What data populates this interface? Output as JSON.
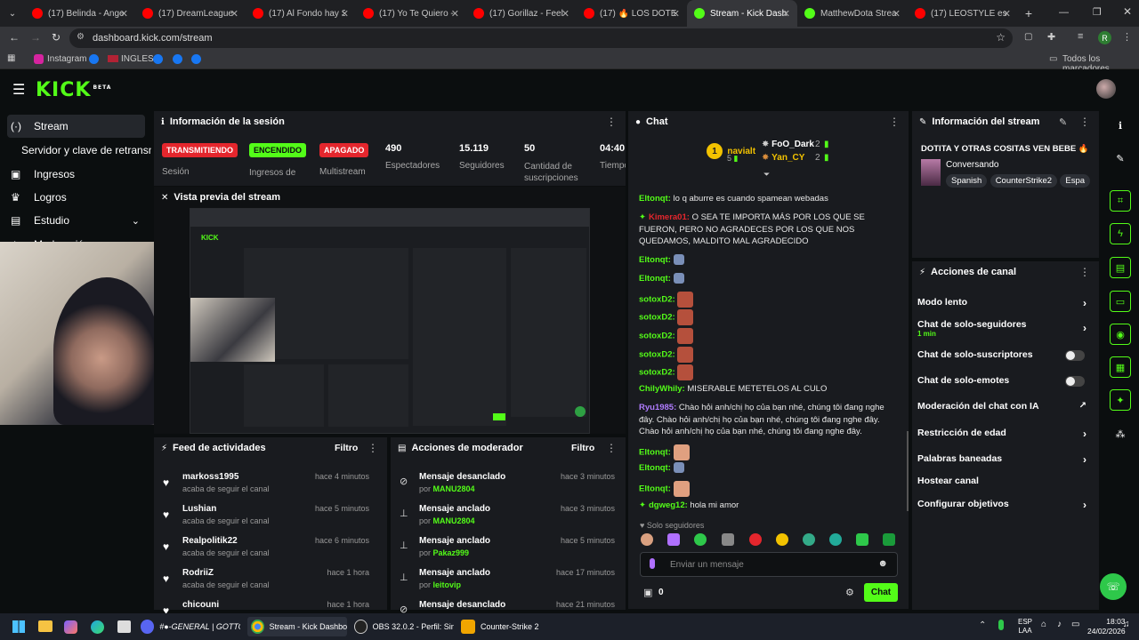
{
  "browser": {
    "tabs": [
      {
        "label": "(17) Belinda - Angel",
        "color": "#ff0000"
      },
      {
        "label": "(17) DreamLeague Se",
        "color": "#ff0000"
      },
      {
        "label": "(17) Al Fondo hay Sit",
        "color": "#ff0000"
      },
      {
        "label": "(17) Yo Te Quiero - Yo",
        "color": "#ff0000"
      },
      {
        "label": "(17) Gorillaz - Feel Go",
        "color": "#ff0000"
      },
      {
        "label": "(17) 🔥 LOS DOTERO",
        "color": "#ff0000"
      },
      {
        "label": "Stream - Kick Dashbo",
        "color": "#53fc18",
        "active": true
      },
      {
        "label": "MatthewDota Stream",
        "color": "#53fc18"
      },
      {
        "label": "(17) LEOSTYLE es un",
        "color": "#ff0000"
      }
    ],
    "url": "dashboard.kick.com/stream",
    "bookmarks": [
      "Instagram",
      "INGLES"
    ],
    "bookmarks_all": "Todos los marcadores",
    "profile_initial": "R"
  },
  "kick": {
    "logo": "KICK",
    "beta": "BETA"
  },
  "sidebar": {
    "items": [
      {
        "label": "Stream",
        "icon": "broadcast-icon"
      },
      {
        "label": "Servidor y clave de retransmisión",
        "icon": ""
      },
      {
        "label": "Ingresos",
        "icon": "wallet-icon"
      },
      {
        "label": "Logros",
        "icon": "trophy-icon"
      },
      {
        "label": "Estudio",
        "icon": "studio-icon"
      },
      {
        "label": "Moderación",
        "icon": "shield-icon"
      }
    ]
  },
  "session": {
    "title": "Información de la sesión",
    "badges": [
      {
        "label": "TRANSMITIENDO",
        "bg": "#e4262d",
        "caption": "Sesión"
      },
      {
        "label": "ENCENDIDO",
        "bg": "#53fc18",
        "caption": "Ingresos de Sesión"
      },
      {
        "label": "APAGADO",
        "bg": "#e4262d",
        "caption": "Multistream"
      }
    ],
    "stats": [
      {
        "value": "490",
        "label": "Espectadores"
      },
      {
        "value": "15.119",
        "label": "Seguidores"
      },
      {
        "value": "50",
        "label": "Cantidad de suscripciones"
      },
      {
        "value": "04:40:",
        "label": "Tiempo en vivo"
      }
    ]
  },
  "preview": {
    "title": "Vista previa del stream"
  },
  "feed": {
    "title": "Feed de actividades",
    "filter": "Filtro",
    "rows": [
      {
        "name": "markoss1995",
        "sub": "acaba de seguir el canal",
        "time": "hace 4 minutos"
      },
      {
        "name": "Lushian",
        "sub": "acaba de seguir el canal",
        "time": "hace 5 minutos"
      },
      {
        "name": "Realpolitik22",
        "sub": "acaba de seguir el canal",
        "time": "hace 6 minutos"
      },
      {
        "name": "RodriiZ",
        "sub": "acaba de seguir el canal",
        "time": "hace 1 hora"
      },
      {
        "name": "chicouni",
        "sub": "",
        "time": "hace 1 hora"
      }
    ]
  },
  "modactions": {
    "title": "Acciones de moderador",
    "filter": "Filtro",
    "rows": [
      {
        "name": "Mensaje desanclado",
        "by_prefix": "por",
        "by": "MANU2804",
        "time": "hace 3 minutos"
      },
      {
        "name": "Mensaje anclado",
        "by_prefix": "por",
        "by": "MANU2804",
        "time": "hace 3 minutos"
      },
      {
        "name": "Mensaje anclado",
        "by_prefix": "por",
        "by": "Pakaz999",
        "time": "hace 5 minutos"
      },
      {
        "name": "Mensaje anclado",
        "by_prefix": "por",
        "by": "leitovip",
        "time": "hace 17 minutos"
      },
      {
        "name": "Mensaje desanclado",
        "by_prefix": "",
        "by": "",
        "time": "hace 21 minutos"
      }
    ]
  },
  "chat": {
    "title": "Chat",
    "top_gifters": [
      {
        "rank": "1",
        "name": "navialt",
        "count": "5"
      },
      {
        "rank": "",
        "name": "FoO_Dark",
        "count": "2"
      },
      {
        "rank": "",
        "name": "Yan_CY",
        "count": "2"
      }
    ],
    "messages": [
      {
        "user": "Eltonqt:",
        "color": "#53fc18",
        "text": "lo q aburre es cuando spamean webadas"
      },
      {
        "user": "Kimera01:",
        "color": "#e4262d",
        "text": "O SEA TE IMPORTA MÁS POR LOS QUE SE FUERON, PERO NO AGRADECES POR LOS QUE NOS QUEDAMOS, MALDITO MAL AGRADECIDO"
      },
      {
        "user": "Eltonqt:",
        "color": "#53fc18",
        "text": ""
      },
      {
        "user": "Eltonqt:",
        "color": "#53fc18",
        "text": ""
      },
      {
        "user": "sotoxD2:",
        "color": "#53fc18",
        "text": ""
      },
      {
        "user": "sotoxD2:",
        "color": "#53fc18",
        "text": ""
      },
      {
        "user": "sotoxD2:",
        "color": "#53fc18",
        "text": ""
      },
      {
        "user": "sotoxD2:",
        "color": "#53fc18",
        "text": ""
      },
      {
        "user": "sotoxD2:",
        "color": "#53fc18",
        "text": ""
      },
      {
        "user": "ChilyWhily:",
        "color": "#53fc18",
        "text": "MISERABLE METETELOS AL CULO"
      },
      {
        "user": "Ryu1985:",
        "color": "#b07cff",
        "text": "Chào hỏi anh/chị họ của bạn nhé, chúng tôi đang nghe đây. Chào hỏi anh/chị họ của bạn nhé, chúng tôi đang nghe đây. Chào hỏi anh/chị họ của bạn nhé, chúng tôi đang nghe đây."
      },
      {
        "user": "Eltonqt:",
        "color": "#53fc18",
        "text": ""
      },
      {
        "user": "Eltonqt:",
        "color": "#53fc18",
        "text": ""
      },
      {
        "user": "Eltonqt:",
        "color": "#53fc18",
        "text": ""
      },
      {
        "user": "dgweg12:",
        "color": "#53fc18",
        "text": "hola mi amor"
      }
    ],
    "followers_only": "Solo seguidores",
    "input_placeholder": "Enviar un mensaje",
    "points": "0",
    "send_label": "Chat"
  },
  "streaminfo": {
    "title": "Información del stream",
    "stream_title": "DOTITA Y OTRAS COSITAS VEN BEBE 🔥",
    "category": "Conversando",
    "tags": [
      "Spanish",
      "CounterStrike2",
      "Espa"
    ]
  },
  "channel_actions": {
    "title": "Acciones de canal",
    "items": [
      {
        "label": "Modo lento",
        "kind": "chevron"
      },
      {
        "label": "Chat de solo-seguidores",
        "sub": "1 min",
        "kind": "chevron"
      },
      {
        "label": "Chat de solo-suscriptores",
        "kind": "toggle"
      },
      {
        "label": "Chat de solo-emotes",
        "kind": "toggle"
      },
      {
        "label": "Moderación del chat con IA",
        "kind": "external"
      },
      {
        "label": "Restricción de edad",
        "kind": "chevron"
      },
      {
        "label": "Palabras baneadas",
        "kind": "chevron"
      },
      {
        "label": "Hostear canal",
        "kind": "none"
      },
      {
        "label": "Configurar objetivos",
        "kind": "chevron"
      }
    ]
  },
  "taskbar": {
    "apps": [
      {
        "label": "#●-GENERAL | GOTTO"
      },
      {
        "label": "Stream - Kick Dashboar"
      },
      {
        "label": "OBS 32.0.2 - Perfil: Sin T"
      },
      {
        "label": "Counter-Strike 2"
      }
    ],
    "lang": "ESP",
    "lang2": "LAA",
    "time": "18:03",
    "date": "24/02/2026"
  }
}
